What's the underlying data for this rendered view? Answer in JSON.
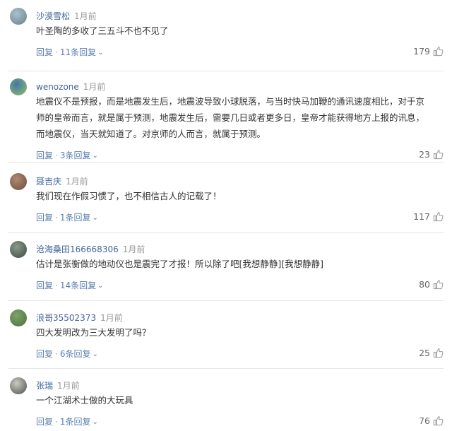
{
  "comments": [
    {
      "user": "沙漠雪松",
      "time": "1月前",
      "text": [
        "叶圣陶的多收了三五斗不也不见了"
      ],
      "reply_label": "回复",
      "sub_label": "11条回复",
      "likes": "179",
      "avatar_colors": [
        "#a9c2cf",
        "#6b7f86"
      ]
    },
    {
      "user": "wenozone",
      "time": "1月前",
      "text": [
        "地震仪不是预报，而是地震发生后，地震波导致小球脱落，与当时快马加鞭的通讯速度相比，对于京",
        "师的皇帝而言，就是属于预测，地震发生后，需要几日或者更多日，皇帝才能获得地方上报的讯息，",
        "而地震仪，当天就知道了。对京师的人而言，就属于预测。"
      ],
      "reply_label": "回复",
      "sub_label": "3条回复",
      "likes": "23",
      "avatar_colors": [
        "#3f78a5",
        "#9bbd6a"
      ]
    },
    {
      "user": "聂吉庆",
      "time": "1月前",
      "text": [
        "我们现在作假习惯了，也不相信古人的记载了！"
      ],
      "reply_label": "回复",
      "sub_label": "1条回复",
      "likes": "117",
      "avatar_colors": [
        "#b08a72",
        "#6b4c3b"
      ]
    },
    {
      "user": "沧海桑田166668306",
      "time": "1月前",
      "text": [
        "估计是张衡做的地动仪也是震完了才报！所以除了吧[我想静静][我想静静]"
      ],
      "reply_label": "回复",
      "sub_label": "14条回复",
      "likes": "80",
      "avatar_colors": [
        "#8a9a8c",
        "#3b4a3e"
      ]
    },
    {
      "user": "浪哥35502373",
      "time": "1月前",
      "text": [
        "四大发明改为三大发明了吗？"
      ],
      "reply_label": "回复",
      "sub_label": "6条回复",
      "likes": "25",
      "avatar_colors": [
        "#7fa36a",
        "#4d6e3c"
      ]
    },
    {
      "user": "张瑞",
      "time": "1月前",
      "text": [
        "一个江湖术士做的大玩具"
      ],
      "reply_label": "回复",
      "sub_label": "1条回复",
      "likes": "76",
      "avatar_colors": [
        "#c9ccc4",
        "#4a4f47"
      ]
    }
  ],
  "colors": {
    "username": "#406599",
    "action": "#5a7fb2",
    "meta": "#999999",
    "divider": "#e6e6e6"
  },
  "icons": {
    "like": "thumb-up-icon",
    "expand": "chevron-down-icon"
  }
}
